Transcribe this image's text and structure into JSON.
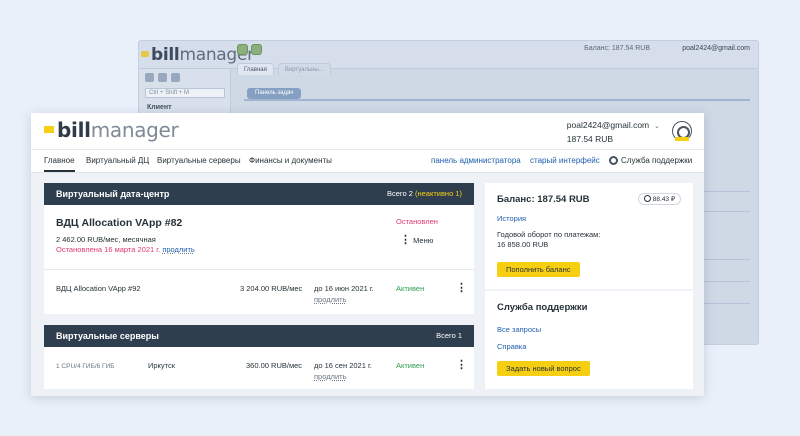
{
  "old_ui": {
    "logo_bill": "bill",
    "logo_manager": "manager",
    "balance": "Баланс: 187.54 RUB",
    "user": "poal2424@gmail.com",
    "search_placeholder": "Ctrl + Shift + M",
    "client_label": "Клиент",
    "tabs": [
      "Главная",
      "Виртуальны..."
    ],
    "panel_tab": "Панель задач"
  },
  "header": {
    "logo_bill": "bill",
    "logo_manager": "manager",
    "user_email": "poal2424@gmail.com",
    "user_balance": "187.54 RUB"
  },
  "nav": {
    "items": [
      "Главное",
      "Виртуальный ДЦ",
      "Виртуальные серверы",
      "Финансы и документы"
    ],
    "admin_panel": "панель администратора",
    "old_interface": "старый интерфейс",
    "support": "Служба поддержки"
  },
  "vdc": {
    "title": "Виртуальный дата-центр",
    "count_prefix": "Всего 2 ",
    "count_inactive": "(неактивно 1)",
    "item1": {
      "name": "ВДЦ Allocation VApp #82",
      "price": "2 462.00 RUB/мес, месячная",
      "stopped_text": "Остановлена 16 марта 2021 г.",
      "extend": "продлить",
      "status": "Остановлен",
      "menu": "Меню"
    },
    "item2": {
      "name": "ВДЦ Allocation VApp #92",
      "price": "3 204.00 RUB/мес",
      "until": "до 16 июн 2021 г.",
      "extend": "продлить",
      "status": "Активен"
    }
  },
  "servers": {
    "title": "Виртуальные серверы",
    "count": "Всего 1",
    "item1": {
      "config": "1 CPU/4 ГИБ/6 ГИБ",
      "location": "Иркутск",
      "price": "360.00 RUB/мес",
      "until": "до 16 сен 2021 г.",
      "extend": "продлить",
      "status": "Активен"
    }
  },
  "balance_card": {
    "title": "Баланс: 187.54 RUB",
    "pill": "88.43 ₽",
    "history": "История",
    "turnover_label": "Годовой оборот по платежам:",
    "turnover_value": "16 858.00 RUB",
    "topup_button": "Пополнить баланс"
  },
  "support_card": {
    "title": "Служба поддержки",
    "all_requests": "Все запросы",
    "help": "Справка",
    "new_request_button": "Задать новый вопрос"
  }
}
